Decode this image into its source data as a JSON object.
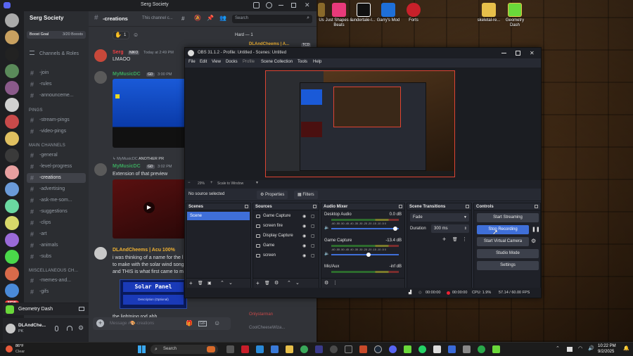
{
  "discord": {
    "app_title": "Serg Society",
    "server_name": "Serg Society",
    "boost_goal": "Boost Goal",
    "boosts": "3/20 Boosts",
    "channels_roles": "Channels & Roles",
    "channels_top": [
      "-join",
      "-rules",
      "-announceme..."
    ],
    "category_pings": "PINGS",
    "channels_pings": [
      "-stream-pings",
      "-video-pings"
    ],
    "category_main": "MAIN CHANNELS",
    "channels_main": [
      "-general",
      "-level-progress",
      "-creations",
      "-advertising",
      "-ask-me-som...",
      "-suggestions",
      "-clips",
      "-art",
      "-animals",
      "-subs"
    ],
    "category_misc": "MISCELLANEOUS CH...",
    "channels_misc": [
      "-memes-and...",
      "-gifs"
    ],
    "voice_server": "Geometry Dash",
    "user_name": "DLAndChe...",
    "user_status": "PK",
    "header_channel": "-creations",
    "header_topic": "This channel c...",
    "search_placeholder": "Search",
    "reaction_count": "1",
    "messages": [
      {
        "author": "Serg",
        "badge": "NIKO",
        "time": "Today at 2:49 PM",
        "text": "LMAOO"
      },
      {
        "author": "MyMusicDC",
        "badge": "GD",
        "time": "3:00 PM",
        "text": ""
      },
      {
        "author": "MyMusicDC",
        "badge": "GD",
        "time": "3:02 PM",
        "text": "Extension of that preview",
        "reply": "ANOTHER PR"
      },
      {
        "author": "DLAndCheems | Acu 100%",
        "badge": "TCD",
        "time": "",
        "text": "i was thinking of a name for the l",
        "text2": "to make with the solar wind song",
        "text3": "and THIS is what first came to m"
      },
      {
        "author": "",
        "badge": "",
        "time": "",
        "text": "the lightning rod ahh"
      }
    ],
    "embed_title": "Solar Panel",
    "embed_subtitle": "Description (Optional)",
    "hard_label": "Hard — 1",
    "side_user": "DLAndCheems | A...",
    "side_user_badge": "TCD",
    "composer_placeholder": "Message #🎨-creations",
    "lower_side_users": [
      "Onlystarman",
      "CoolCheeseWiza..."
    ],
    "new_badge": "NEW"
  },
  "obs": {
    "title": "OBS 31.1.2 - Profile: Untitled - Scenes: Untitled",
    "menu": [
      "File",
      "Edit",
      "View",
      "Docks",
      "Profile",
      "Scene Collection",
      "Tools",
      "Help"
    ],
    "zoom": "29%",
    "scale_mode": "Scale to Window",
    "no_source": "No source selected",
    "properties": "Properties",
    "filters": "Filters",
    "docks": {
      "scenes": "Scenes",
      "sources": "Sources",
      "audio_mixer": "Audio Mixer",
      "transitions": "Scene Transitions",
      "controls": "Controls"
    },
    "scenes": [
      "Scene"
    ],
    "sources": [
      "Game Capture",
      "screen fire",
      "Display Capture",
      "Game",
      "screen"
    ],
    "audio": [
      {
        "name": "Desktop Audio",
        "db": "0.0 dB",
        "level": 0.95
      },
      {
        "name": "Game Capture",
        "db": "-13.4 dB",
        "level": 0.55
      },
      {
        "name": "Mic/Aux",
        "db": "-inf dB",
        "level": 0.0
      }
    ],
    "meter_scale": "-60 -55 -50 -45 -40 -35 -30 -25 -20 -15 -10 -5 0",
    "transition": "Fade",
    "duration_label": "Duration",
    "duration": "300 ms",
    "controls": [
      "Start Streaming",
      "Stop Recording",
      "Start Virtual Camera",
      "Studio Mode",
      "Settings"
    ],
    "status": {
      "rec_time1": "00:00:00",
      "rec_time2": "00:00:00",
      "cpu": "CPU: 1.9%",
      "fps": "57.14 / 60.00 FPS"
    }
  },
  "desktop": {
    "icons_top": [
      "Us",
      "Just Shapes & Beats",
      "undertale-l...",
      "Garry's Mod",
      "Forts"
    ],
    "icons_right": [
      "skeletal-re...",
      "Geometry Dash"
    ]
  },
  "taskbar": {
    "weather_temp": "86°F",
    "weather_desc": "Clear",
    "search": "Search",
    "time": "10:22 PM",
    "date": "9/2/2025"
  },
  "colors": {
    "accent": "#3f6fd8",
    "discord_bg": "#313338",
    "obs_bg": "#272a33"
  }
}
